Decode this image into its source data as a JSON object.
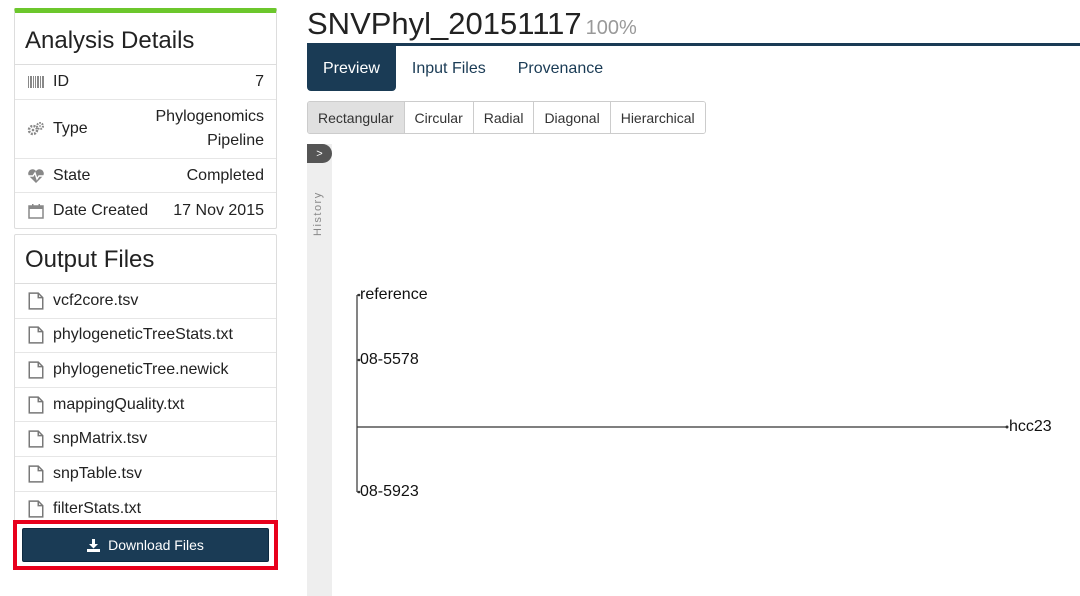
{
  "analysis_details": {
    "title": "Analysis Details",
    "rows": [
      {
        "label": "ID",
        "value": "7",
        "icon": "barcode-icon"
      },
      {
        "label": "Type",
        "value": "Phylogenomics\nPipeline",
        "icon": "gears-icon"
      },
      {
        "label": "State",
        "value": "Completed",
        "icon": "heartbeat-icon"
      },
      {
        "label": "Date Created",
        "value": "17 Nov 2015",
        "icon": "calendar-icon"
      }
    ]
  },
  "output_files": {
    "title": "Output Files",
    "files": [
      "vcf2core.tsv",
      "phylogeneticTreeStats.txt",
      "phylogeneticTree.newick",
      "mappingQuality.txt",
      "snpMatrix.tsv",
      "snpTable.tsv",
      "filterStats.txt"
    ],
    "download_label": "Download Files"
  },
  "header": {
    "title": "SNVPhyl_20151117",
    "progress": "100%"
  },
  "tabs": [
    {
      "label": "Preview",
      "active": true
    },
    {
      "label": "Input Files",
      "active": false
    },
    {
      "label": "Provenance",
      "active": false
    }
  ],
  "layouts": [
    {
      "label": "Rectangular",
      "active": true
    },
    {
      "label": "Circular",
      "active": false
    },
    {
      "label": "Radial",
      "active": false
    },
    {
      "label": "Diagonal",
      "active": false
    },
    {
      "label": "Hierarchical",
      "active": false
    }
  ],
  "history": {
    "toggle": ">",
    "label": "History"
  },
  "tree": {
    "leaves": [
      "reference",
      "08-5578",
      "hcc23",
      "08-5923"
    ]
  },
  "colors": {
    "accent": "#1a3b55",
    "success_bar": "#6cc72c",
    "highlight": "#e8001c"
  }
}
